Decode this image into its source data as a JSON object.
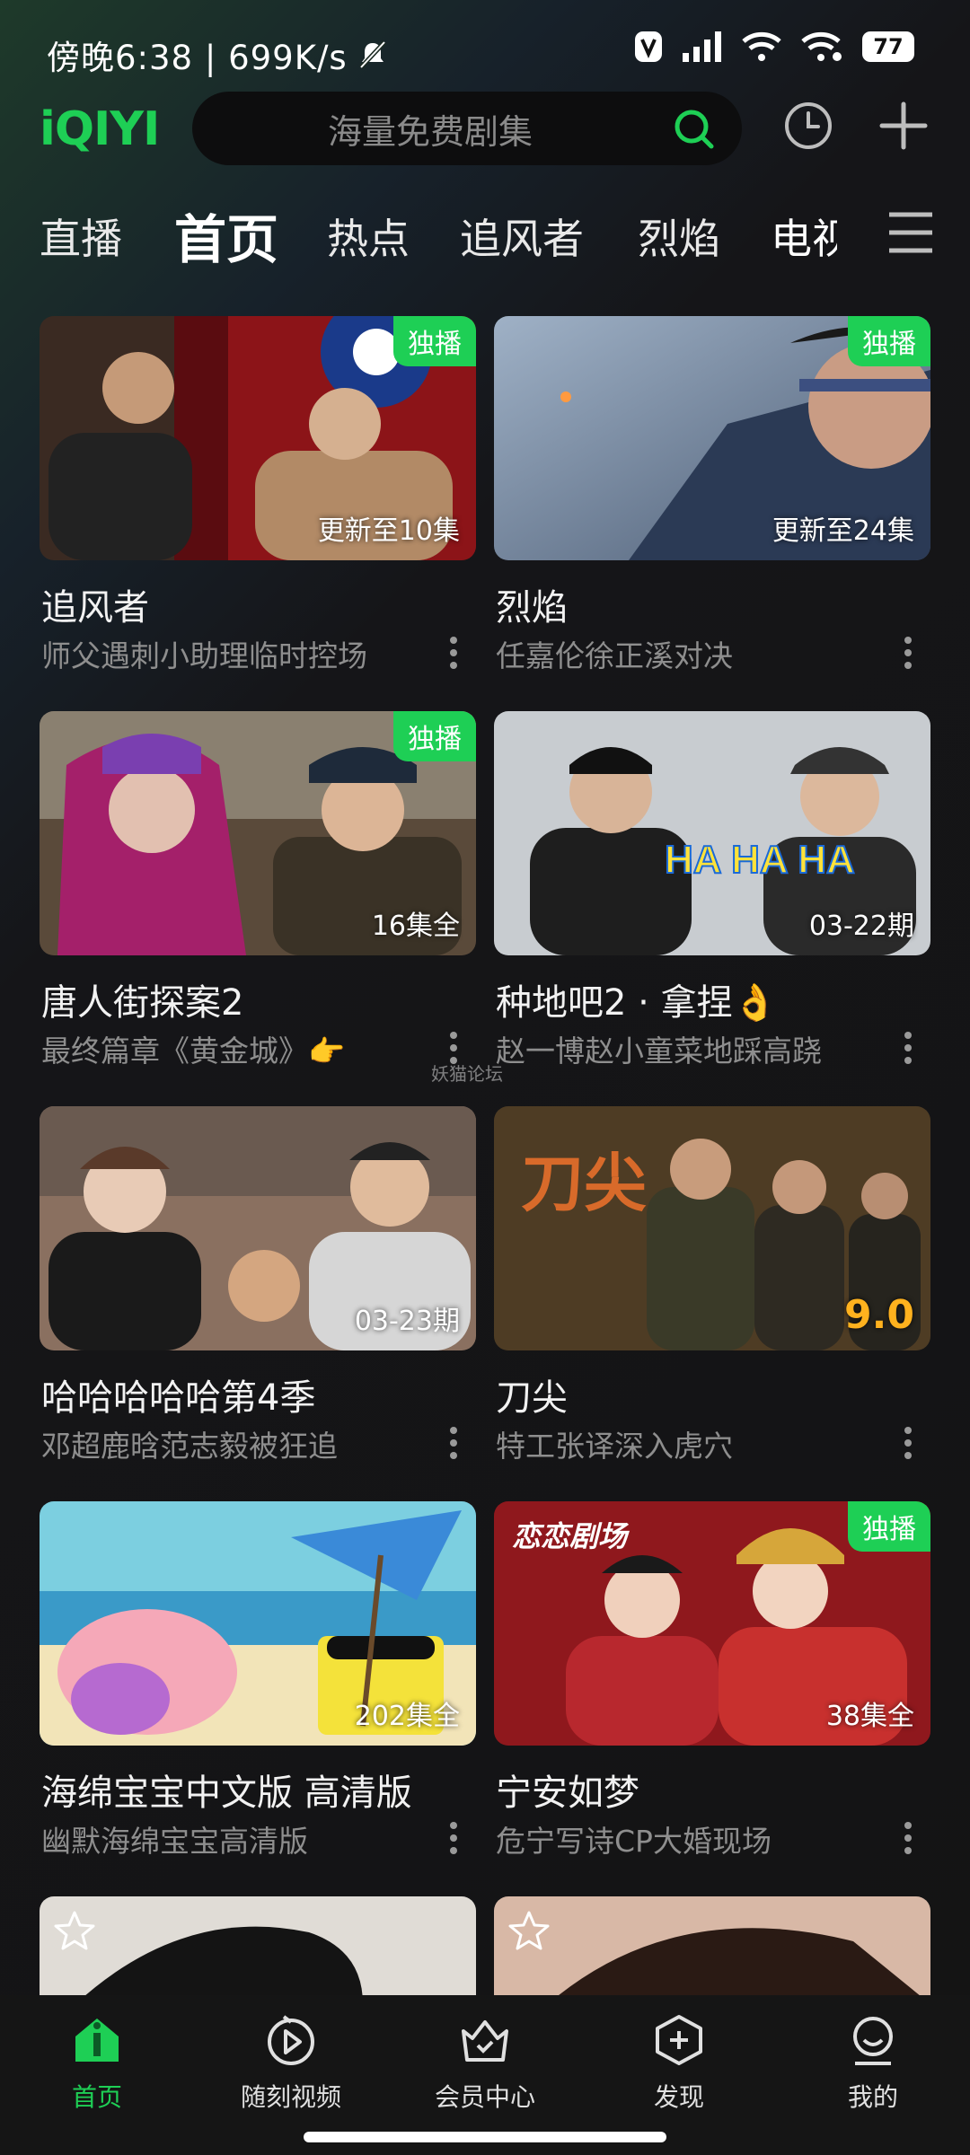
{
  "status_bar": {
    "time_text": "傍晚6:38 | 699K/s",
    "battery": "77"
  },
  "header": {
    "logo": "iQIYI",
    "search_placeholder": "海量免费剧集"
  },
  "tabs": [
    "直播",
    "首页",
    "热点",
    "追风者",
    "烈焰",
    "电视"
  ],
  "active_tab": "首页",
  "cards": [
    {
      "title": "追风者",
      "subtitle": "师父遇刺小助理临时控场",
      "badge": "独播",
      "corner": "更新至10集"
    },
    {
      "title": "烈焰",
      "subtitle": "任嘉伦徐正溪对决",
      "badge": "独播",
      "corner": "更新至24集"
    },
    {
      "title": "唐人街探案2",
      "subtitle": "最终篇章《黄金城》👉",
      "badge": "独播",
      "corner": "16集全"
    },
    {
      "title": "种地吧2 · 拿捏👌",
      "subtitle": "赵一博赵小童菜地踩高跷",
      "badge": "",
      "corner": "03-22期"
    },
    {
      "title": "哈哈哈哈哈第4季",
      "subtitle": "邓超鹿晗范志毅被狂追",
      "badge": "",
      "corner": "03-23期"
    },
    {
      "title": "刀尖",
      "subtitle": "特工张译深入虎穴",
      "badge": "",
      "corner": "9.0"
    },
    {
      "title": "海绵宝宝中文版 高清版",
      "subtitle": "幽默海绵宝宝高清版",
      "badge": "",
      "corner": "202集全"
    },
    {
      "title": "宁安如梦",
      "subtitle": "危宁写诗CP大婚现场",
      "badge": "独播",
      "corner": "38集全"
    }
  ],
  "thumb_art": {
    "haha_text": "HA HA HA",
    "daojian_text": "刀尖",
    "lianlian_text": "恋恋剧场"
  },
  "watermark": "妖猫论坛",
  "bottom_nav": [
    "首页",
    "随刻视频",
    "会员中心",
    "发现",
    "我的"
  ],
  "colors": {
    "accent": "#1ecf55",
    "score": "#ffb21e"
  }
}
